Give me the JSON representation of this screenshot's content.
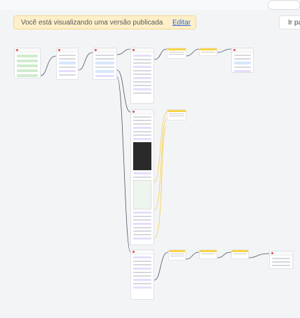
{
  "banner": {
    "message": "Você está visualizando uma versão publicada",
    "edit_label": "Editar"
  },
  "goto_label": "Ir para"
}
